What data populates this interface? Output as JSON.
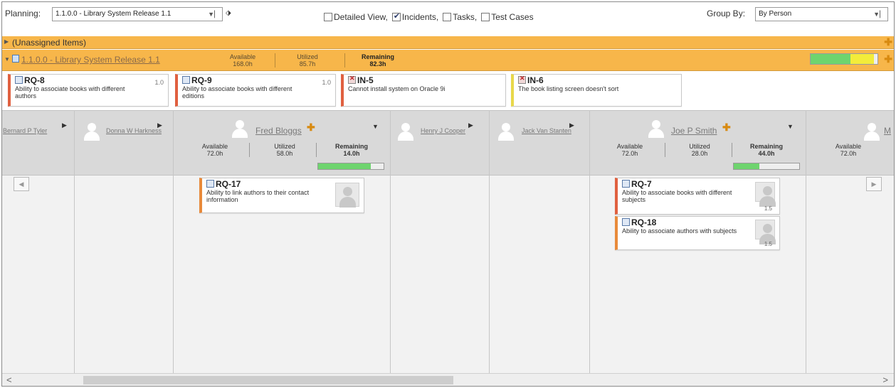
{
  "toolbar": {
    "planning_label": "Planning:",
    "planning_value": "1.1.0.0 - Library System Release 1.1",
    "detailed_view_label": "Detailed View,",
    "incidents_label": "Incidents,",
    "tasks_label": "Tasks,",
    "test_cases_label": "Test Cases",
    "detailed_view_checked": false,
    "incidents_checked": true,
    "tasks_checked": false,
    "test_cases_checked": false,
    "group_by_label": "Group By:",
    "group_by_value": "By Person"
  },
  "unassigned": {
    "label": "(Unassigned Items)"
  },
  "release": {
    "title": "1.1.0.0 - Library System Release 1.1",
    "available_label": "Available",
    "available_value": "168.0h",
    "utilized_label": "Utilized",
    "utilized_value": "85.7h",
    "remaining_label": "Remaining",
    "remaining_value": "82.3h",
    "progress": {
      "green_fraction": 0.6,
      "yellow_fraction": 0.35
    }
  },
  "backlog": [
    {
      "id": "RQ-8",
      "desc_1": "Ability to associate books with different",
      "desc_2": "authors",
      "estimate": "1.0",
      "type": "requirement"
    },
    {
      "id": "RQ-9",
      "desc_1": "Ability to associate books with different",
      "desc_2": "editions",
      "estimate": "1.0",
      "type": "requirement"
    },
    {
      "id": "IN-5",
      "desc_1": "Cannot install system on Oracle 9i",
      "desc_2": "",
      "estimate": "",
      "type": "incident"
    },
    {
      "id": "IN-6",
      "desc_1": "The book listing screen doesn't sort",
      "desc_2": "",
      "estimate": "",
      "type": "incident"
    }
  ],
  "people": [
    {
      "name": "Bernard P Tyler"
    },
    {
      "name": "Donna W Harkness"
    },
    {
      "name": "Fred Bloggs",
      "available_label": "Available",
      "available": "72.0h",
      "utilized_label": "Utilized",
      "utilized": "58.0h",
      "remaining_label": "Remaining",
      "remaining": "14.0h",
      "progress_fraction": 0.8
    },
    {
      "name": "Henry J Cooper"
    },
    {
      "name": "Jack Van Stanten"
    },
    {
      "name": "Joe P Smith",
      "available_label": "Available",
      "available": "72.0h",
      "utilized_label": "Utilized",
      "utilized": "28.0h",
      "remaining_label": "Remaining",
      "remaining": "44.0h",
      "progress_fraction": 0.39
    },
    {
      "name": "M",
      "available_label": "Available",
      "available": "72.0h"
    }
  ],
  "board_items": [
    {
      "id": "RQ-17",
      "desc_1": "Ability to link authors to their contact",
      "desc_2": "information",
      "estimate": ""
    },
    {
      "id": "RQ-7",
      "desc_1": "Ability to associate books with different",
      "desc_2": "subjects",
      "estimate": "1.5"
    },
    {
      "id": "RQ-18",
      "desc_1": "Ability to associate authors with subjects",
      "desc_2": "",
      "estimate": "1.5"
    }
  ],
  "colors": {
    "orange_bar": "#f7b64a",
    "card_accent_red": "#e06040",
    "card_accent_orange": "#e88a3a",
    "card_accent_yellow": "#e8d84a",
    "progress_green": "#6ed46e",
    "progress_yellow": "#f3ec3a",
    "people_header_bg": "#d9d9d9"
  },
  "icons": {
    "requirement": "requirement-icon",
    "incident": "incident-icon",
    "add": "plus-icon"
  }
}
